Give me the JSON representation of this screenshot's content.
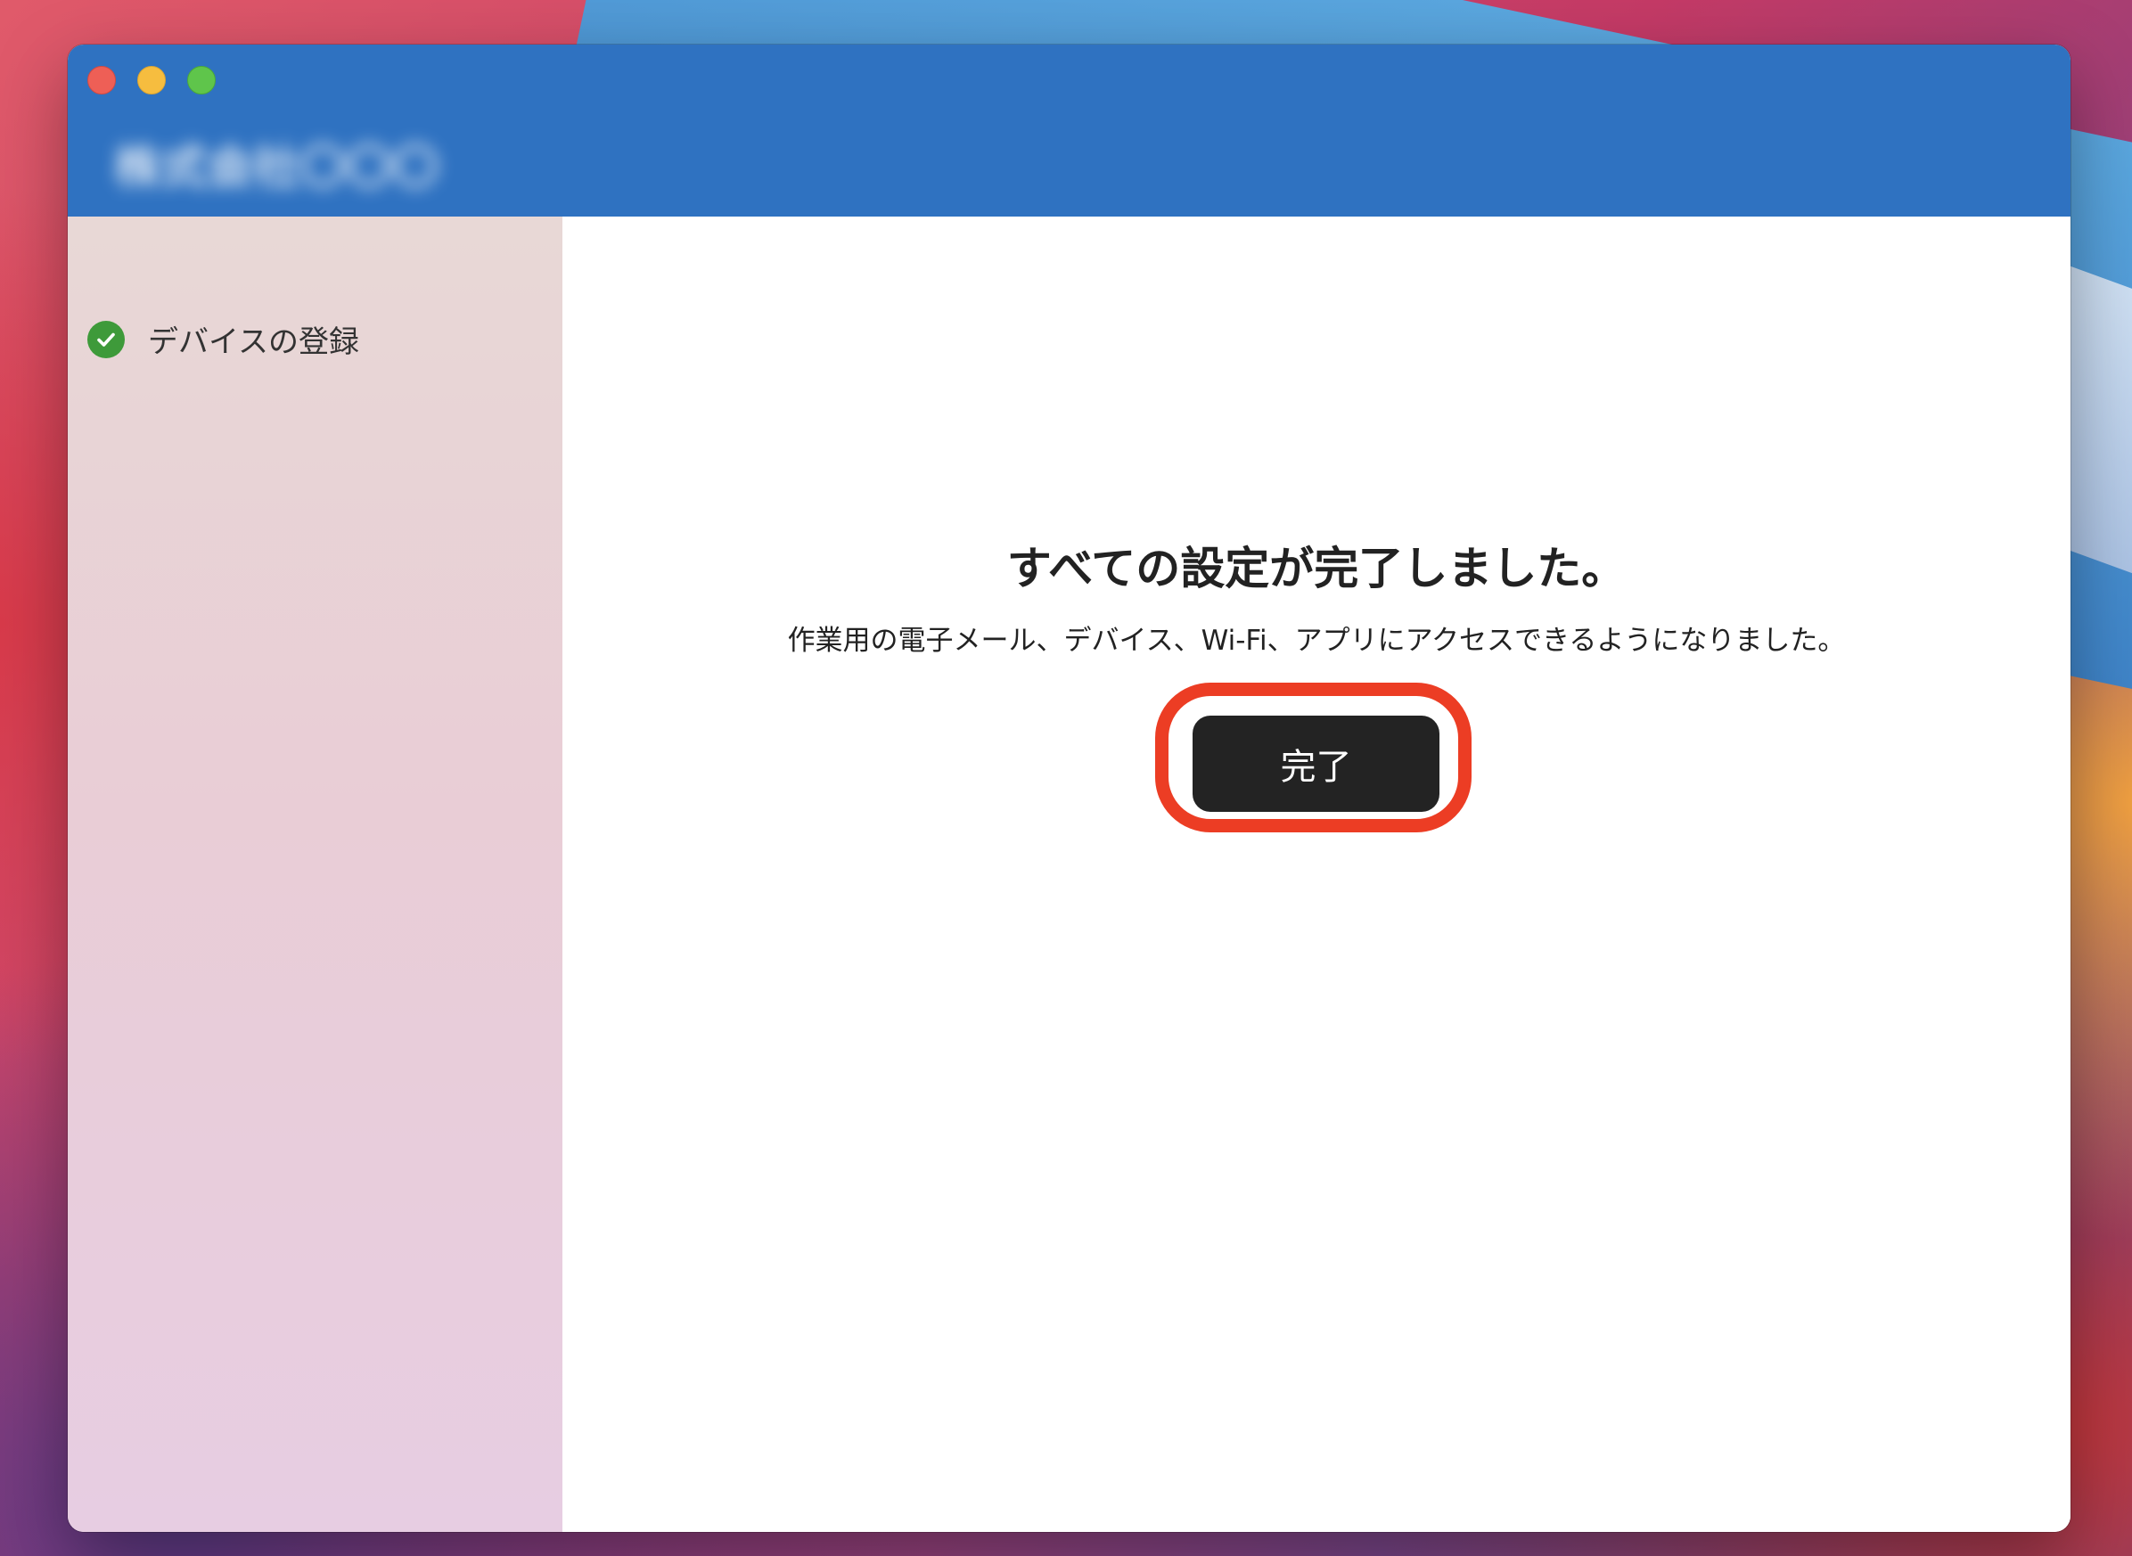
{
  "window": {
    "org_name": "株式会社〇〇〇"
  },
  "sidebar": {
    "items": [
      {
        "label": "デバイスの登録",
        "status": "complete",
        "icon": "check-circle-icon"
      }
    ]
  },
  "main": {
    "headline": "すべての設定が完了しました。",
    "subtext": "作業用の電子メール、デバイス、Wi-Fi、アプリにアクセスできるようになりました。",
    "done_button_label": "完了"
  },
  "colors": {
    "titlebar": "#2f72c1",
    "button": "#232323",
    "highlight": "#ec3d24",
    "check": "#3e9a3a"
  }
}
